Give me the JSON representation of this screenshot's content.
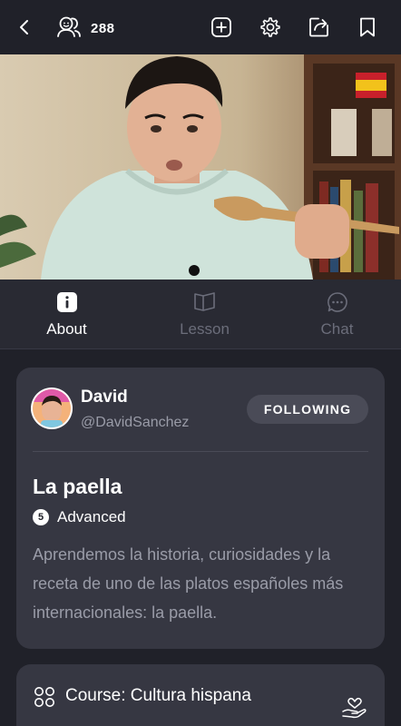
{
  "header": {
    "viewer_count": "288",
    "icons": [
      "back-chevron-icon",
      "viewers-icon",
      "add-icon",
      "settings-gear-icon",
      "share-icon",
      "bookmark-icon"
    ]
  },
  "video": {
    "description": "Presenter in mint hoodie holding wooden spoon in front of bookshelf with Spanish flag"
  },
  "tabs": [
    {
      "label": "About",
      "icon": "info-icon",
      "active": true
    },
    {
      "label": "Lesson",
      "icon": "book-icon",
      "active": false
    },
    {
      "label": "Chat",
      "icon": "chat-bubble-icon",
      "active": false
    }
  ],
  "author": {
    "name": "David",
    "handle": "@DavidSanchez",
    "follow_label": "FOLLOWING"
  },
  "lesson": {
    "title": "La paella",
    "level_number": "5",
    "level_label": "Advanced",
    "description": "Aprendemos la historia, curiosidades y la receta de uno de las platos españoles más internacionales: la paella."
  },
  "course": {
    "label": "Course: Cultura hispana",
    "icon": "grid-circles-icon",
    "action_icon": "heart-hand-icon"
  },
  "colors": {
    "background": "#202129",
    "card": "#363742",
    "tabbar": "#292a33",
    "muted_text": "#9a9ca8",
    "inactive_tab": "#6b6d7a"
  }
}
